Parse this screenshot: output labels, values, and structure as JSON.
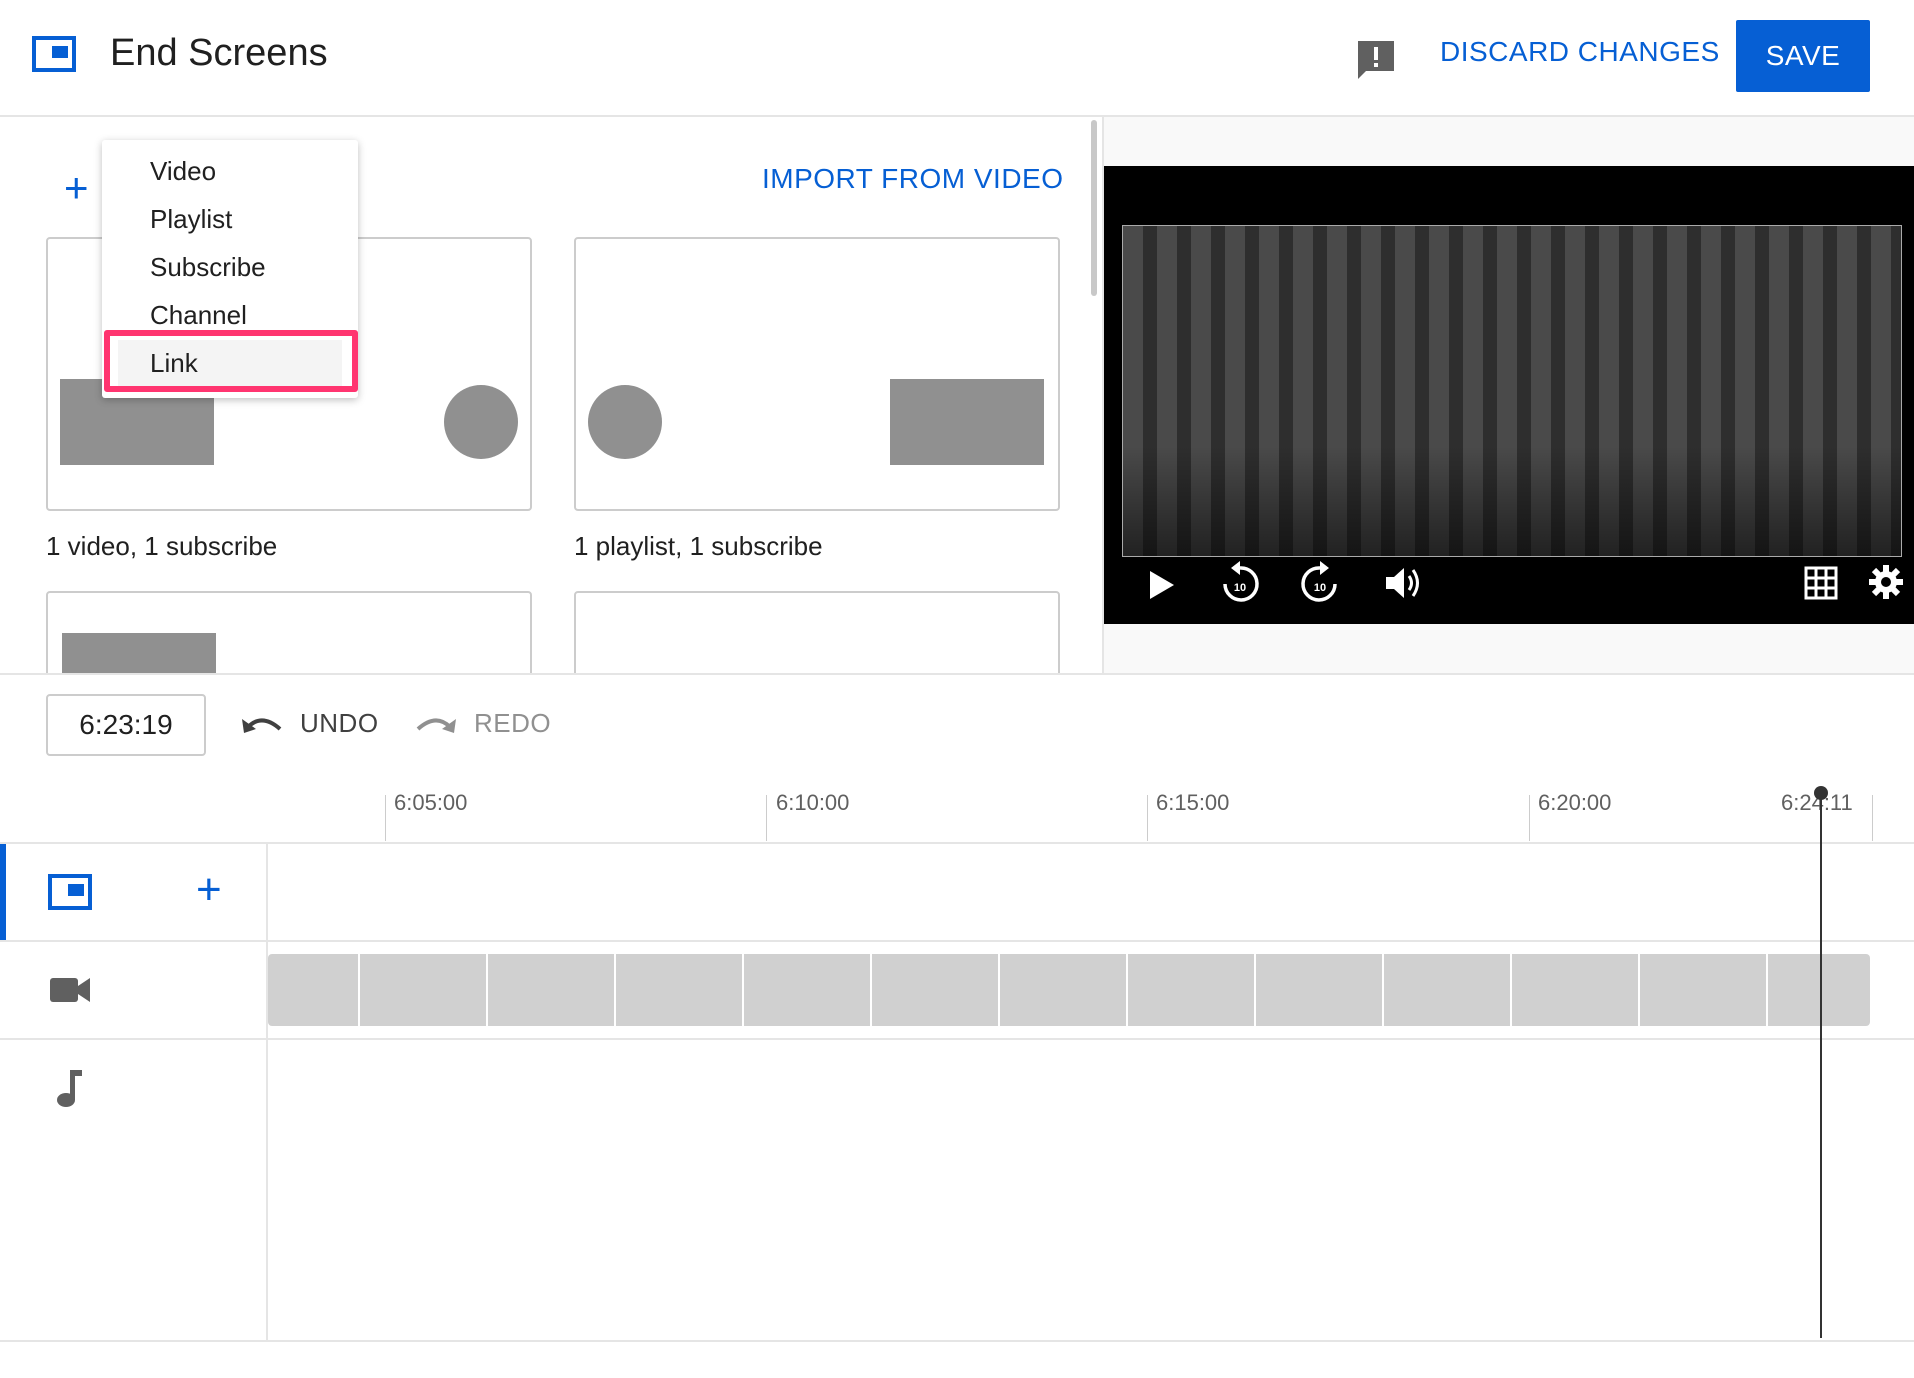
{
  "header": {
    "title": "End Screens",
    "discard_label": "DISCARD CHANGES",
    "save_label": "SAVE"
  },
  "left_panel": {
    "add_icon": "+",
    "import_label": "IMPORT FROM VIDEO",
    "templates": [
      {
        "label": "1 video, 1 subscribe"
      },
      {
        "label": "1 playlist, 1 subscribe"
      }
    ]
  },
  "add_menu": {
    "items": [
      "Video",
      "Playlist",
      "Subscribe",
      "Channel",
      "Link"
    ],
    "highlighted": "Link"
  },
  "toolbar": {
    "current_time": "6:23:19",
    "undo_label": "UNDO",
    "redo_label": "REDO"
  },
  "timeline": {
    "ticks": [
      "6:05:00",
      "6:10:00",
      "6:15:00",
      "6:20:00",
      "6:24:11"
    ],
    "track_add_icon": "+"
  },
  "icons": {
    "end_screen": "end-screen-icon",
    "feedback": "feedback-icon",
    "video_track": "video-camera-icon",
    "audio_track": "music-note-icon",
    "play": "play-icon",
    "rewind": "rewind-10-icon",
    "forward": "forward-10-icon",
    "volume": "volume-icon",
    "grid": "grid-icon",
    "settings": "gear-icon"
  },
  "colors": {
    "accent": "#065fd4",
    "highlight": "#ff3570"
  }
}
